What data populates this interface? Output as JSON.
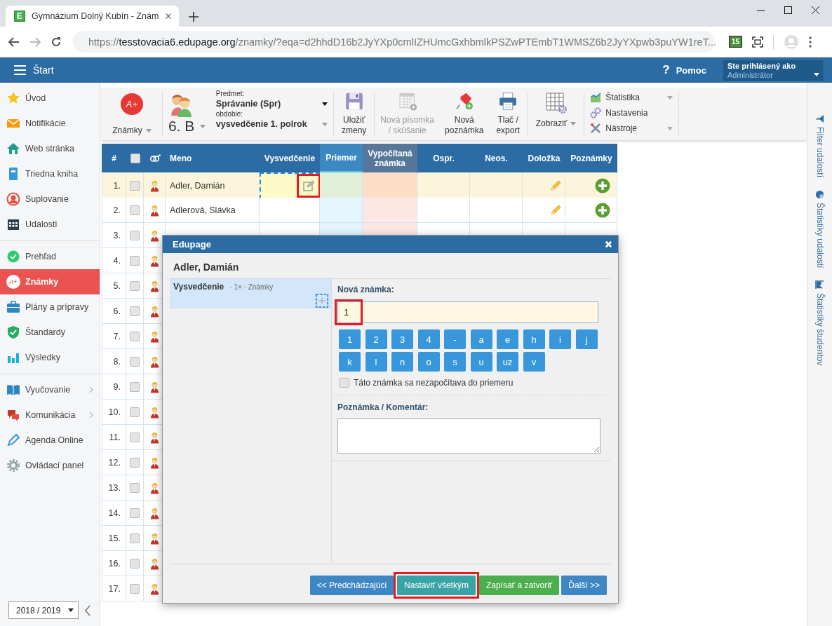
{
  "browser": {
    "favicon": "E",
    "tab_title": "Gymnázium Dolný Kubín - Znám",
    "url_scheme": "https://",
    "url_host": "tesstovacia6.edupage.org",
    "url_path": "/znamky/?eqa=d2hhdD16b2JyYXp0cmlIZHUmcGxhbmlkPSZwPTEmbT1WMSZ6b2JyYXpwb3puYW1reT...",
    "extension_badge": "15"
  },
  "header": {
    "menu_label": "Štart",
    "help_icon": "?",
    "help_label": "Pomoc",
    "user_caption": "Ste prihlásený ako",
    "user_name": "Administrátor"
  },
  "sidebar": {
    "groups": [
      [
        {
          "label": "Úvod",
          "selected": false,
          "submenu": false
        },
        {
          "label": "Notifikácie",
          "selected": false,
          "submenu": false
        },
        {
          "label": "Web stránka",
          "selected": false,
          "submenu": false
        },
        {
          "label": "Triedna kniha",
          "selected": false,
          "submenu": false
        },
        {
          "label": "Suplovanie",
          "selected": false,
          "submenu": false
        },
        {
          "label": "Udalosti",
          "selected": false,
          "submenu": false
        }
      ],
      [
        {
          "label": "Prehľad",
          "selected": false,
          "submenu": false
        },
        {
          "label": "Známky",
          "icon_text": "A+",
          "selected": true,
          "submenu": false
        },
        {
          "label": "Plány a prípravy",
          "selected": false,
          "submenu": false
        },
        {
          "label": "Štandardy",
          "selected": false,
          "submenu": false
        },
        {
          "label": "Výsledky",
          "selected": false,
          "submenu": false
        }
      ],
      [
        {
          "label": "Vyučovanie",
          "selected": false,
          "submenu": true
        },
        {
          "label": "Komunikácia",
          "selected": false,
          "submenu": true
        },
        {
          "label": "Agenda Online",
          "selected": false,
          "submenu": false
        },
        {
          "label": "Ovládací panel",
          "selected": false,
          "submenu": false
        }
      ]
    ],
    "year": "2018 / 2019"
  },
  "toolbar": {
    "grades_icon_text": "A+",
    "grades_label": "Známky",
    "class_name": "6. B",
    "subject_caption": "Predmet:",
    "subject": "Správanie (Spr)",
    "period_caption": "obdobie:",
    "period": "vysvedčenie 1. polrok",
    "action_groups": [
      [
        {
          "lines": [
            "Uložiť",
            "zmeny"
          ],
          "disabled": false,
          "dropdown": false
        }
      ],
      [
        {
          "lines": [
            "Nová písomka",
            "/ skúšanie"
          ],
          "disabled": true,
          "dropdown": false
        },
        {
          "lines": [
            "Nová",
            "poznámka"
          ],
          "disabled": false,
          "dropdown": false
        },
        {
          "lines": [
            "Tlač /",
            "export"
          ],
          "disabled": false,
          "dropdown": false
        }
      ],
      [
        {
          "lines": [
            "Zobraziť"
          ],
          "disabled": false,
          "dropdown": true
        }
      ]
    ],
    "menu": [
      {
        "label": "Štatistika",
        "dropdown": true
      },
      {
        "label": "Nastavenia",
        "dropdown": false
      },
      {
        "label": "Nástroje",
        "dropdown": true
      }
    ]
  },
  "table": {
    "header_checked": false,
    "columns": [
      "#",
      "Meno",
      "Vysvedčenie",
      "Priemer",
      "Vypočítaná známka",
      "Ospr.",
      "Neos.",
      "Doložka",
      "Poznámky"
    ],
    "edit_highlighted": true,
    "rows": [
      {
        "number": "1.",
        "checked": false,
        "name": "Adler, Damián",
        "selected": true
      },
      {
        "number": "2.",
        "checked": false,
        "name": "Adlerová, Slávka",
        "selected": false
      },
      {
        "number": "3.",
        "checked": false,
        "selected": false
      },
      {
        "number": "4.",
        "checked": false,
        "selected": false
      },
      {
        "number": "5.",
        "checked": false,
        "selected": false
      },
      {
        "number": "6.",
        "checked": false,
        "selected": false
      },
      {
        "number": "7.",
        "checked": false,
        "selected": false
      },
      {
        "number": "8.",
        "checked": false,
        "selected": false
      },
      {
        "number": "9.",
        "checked": false,
        "selected": false
      },
      {
        "number": "10.",
        "checked": false,
        "selected": false
      },
      {
        "number": "11.",
        "checked": false,
        "selected": false
      },
      {
        "number": "12.",
        "checked": false,
        "selected": false
      },
      {
        "number": "13.",
        "checked": false,
        "selected": false
      },
      {
        "number": "14.",
        "checked": false,
        "selected": false
      },
      {
        "number": "15.",
        "checked": false,
        "selected": false
      },
      {
        "number": "16.",
        "checked": false,
        "selected": false
      },
      {
        "number": "17.",
        "checked": false,
        "selected": false
      }
    ]
  },
  "right_panel": [
    {
      "label": "Filter udalostí"
    },
    {
      "label": "Štatistiky udalostí"
    },
    {
      "label": "Štatistiky študentov"
    }
  ],
  "dialog": {
    "title": "Edupage",
    "student": "Adler, Damián",
    "items": [
      {
        "label": "Vysvedčenie",
        "meta": "· 1× · Známky",
        "selected": true
      }
    ],
    "grade_label": "Nová známka:",
    "grade_value": "1",
    "grade_highlighted": true,
    "grade_keys": [
      "1",
      "2",
      "3",
      "4",
      "-",
      "a",
      "e",
      "h",
      "i",
      "j",
      "k",
      "l",
      "n",
      "o",
      "s",
      "u",
      "uz",
      "v"
    ],
    "exclude": {
      "label": "Táto známka sa nezapočítava do priemeru",
      "checked": false
    },
    "comment_label": "Poznámka / Komentár:",
    "buttons": [
      {
        "label": "<< Predchádzajúci",
        "kind": "primary",
        "highlighted": false
      },
      {
        "label": "Nastaviť všetkým",
        "kind": "teal",
        "highlighted": true
      },
      {
        "label": "Zapísať a zatvoriť",
        "kind": "success",
        "highlighted": false
      },
      {
        "label": "Ďalší >>",
        "kind": "primary",
        "highlighted": false
      }
    ]
  }
}
